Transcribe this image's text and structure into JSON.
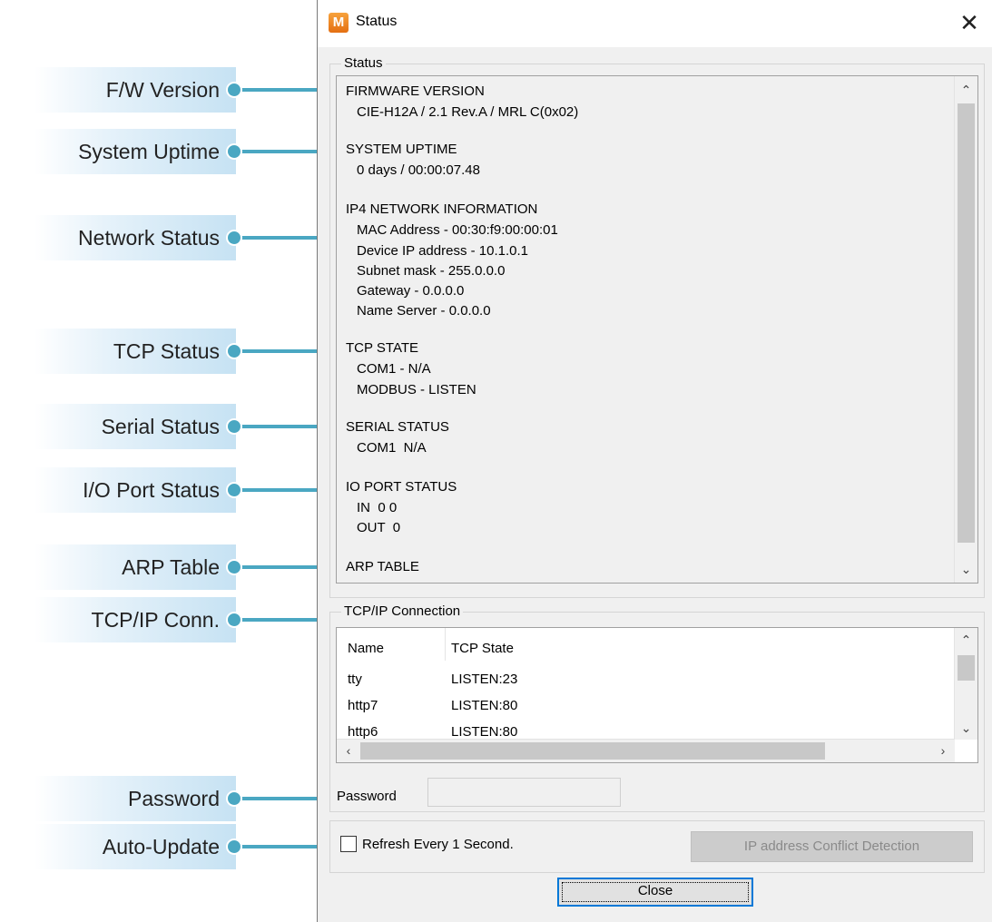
{
  "window": {
    "title": "Status",
    "icon_letter": "M",
    "close_glyph": "✕"
  },
  "status_group": {
    "label": "Status",
    "sections": [
      {
        "heading": "FIRMWARE VERSION",
        "lines": [
          "CIE-H12A / 2.1 Rev.A / MRL C(0x02)"
        ]
      },
      {
        "heading": "SYSTEM UPTIME",
        "lines": [
          "0 days / 00:00:07.48"
        ]
      },
      {
        "heading": "IP4 NETWORK INFORMATION",
        "lines": [
          "MAC Address - 00:30:f9:00:00:01",
          "Device IP address - 10.1.0.1",
          "Subnet mask - 255.0.0.0",
          "Gateway - 0.0.0.0",
          "Name Server - 0.0.0.0"
        ]
      },
      {
        "heading": "TCP STATE",
        "lines": [
          "COM1 - N/A",
          "MODBUS - LISTEN"
        ]
      },
      {
        "heading": "SERIAL STATUS",
        "lines": [
          "COM1  N/A"
        ]
      },
      {
        "heading": "IO PORT STATUS",
        "lines": [
          "IN  0 0",
          "OUT  0"
        ]
      },
      {
        "heading": "ARP TABLE",
        "lines": []
      }
    ]
  },
  "tcp_group": {
    "label": "TCP/IP Connection",
    "columns": [
      "Name",
      "TCP State"
    ],
    "rows": [
      {
        "name": "tty",
        "state": "LISTEN:23"
      },
      {
        "name": "http7",
        "state": "LISTEN:80"
      },
      {
        "name": "http6",
        "state": "LISTEN:80"
      }
    ],
    "password_label": "Password",
    "password_value": ""
  },
  "refresh": {
    "checkbox_label": "Refresh Every 1 Second.",
    "checked": false,
    "conflict_button": "IP address Conflict Detection"
  },
  "close_button": "Close",
  "callouts": [
    "F/W Version",
    "System Uptime",
    "Network Status",
    "TCP Status",
    "Serial Status",
    "I/O Port Status",
    "ARP Table",
    "TCP/IP Conn.",
    "Password",
    "Auto-Update"
  ],
  "colors": {
    "callout_line": "#4aa7c2",
    "callout_bg": "#c6e2f3",
    "focus_border": "#0078d7"
  }
}
